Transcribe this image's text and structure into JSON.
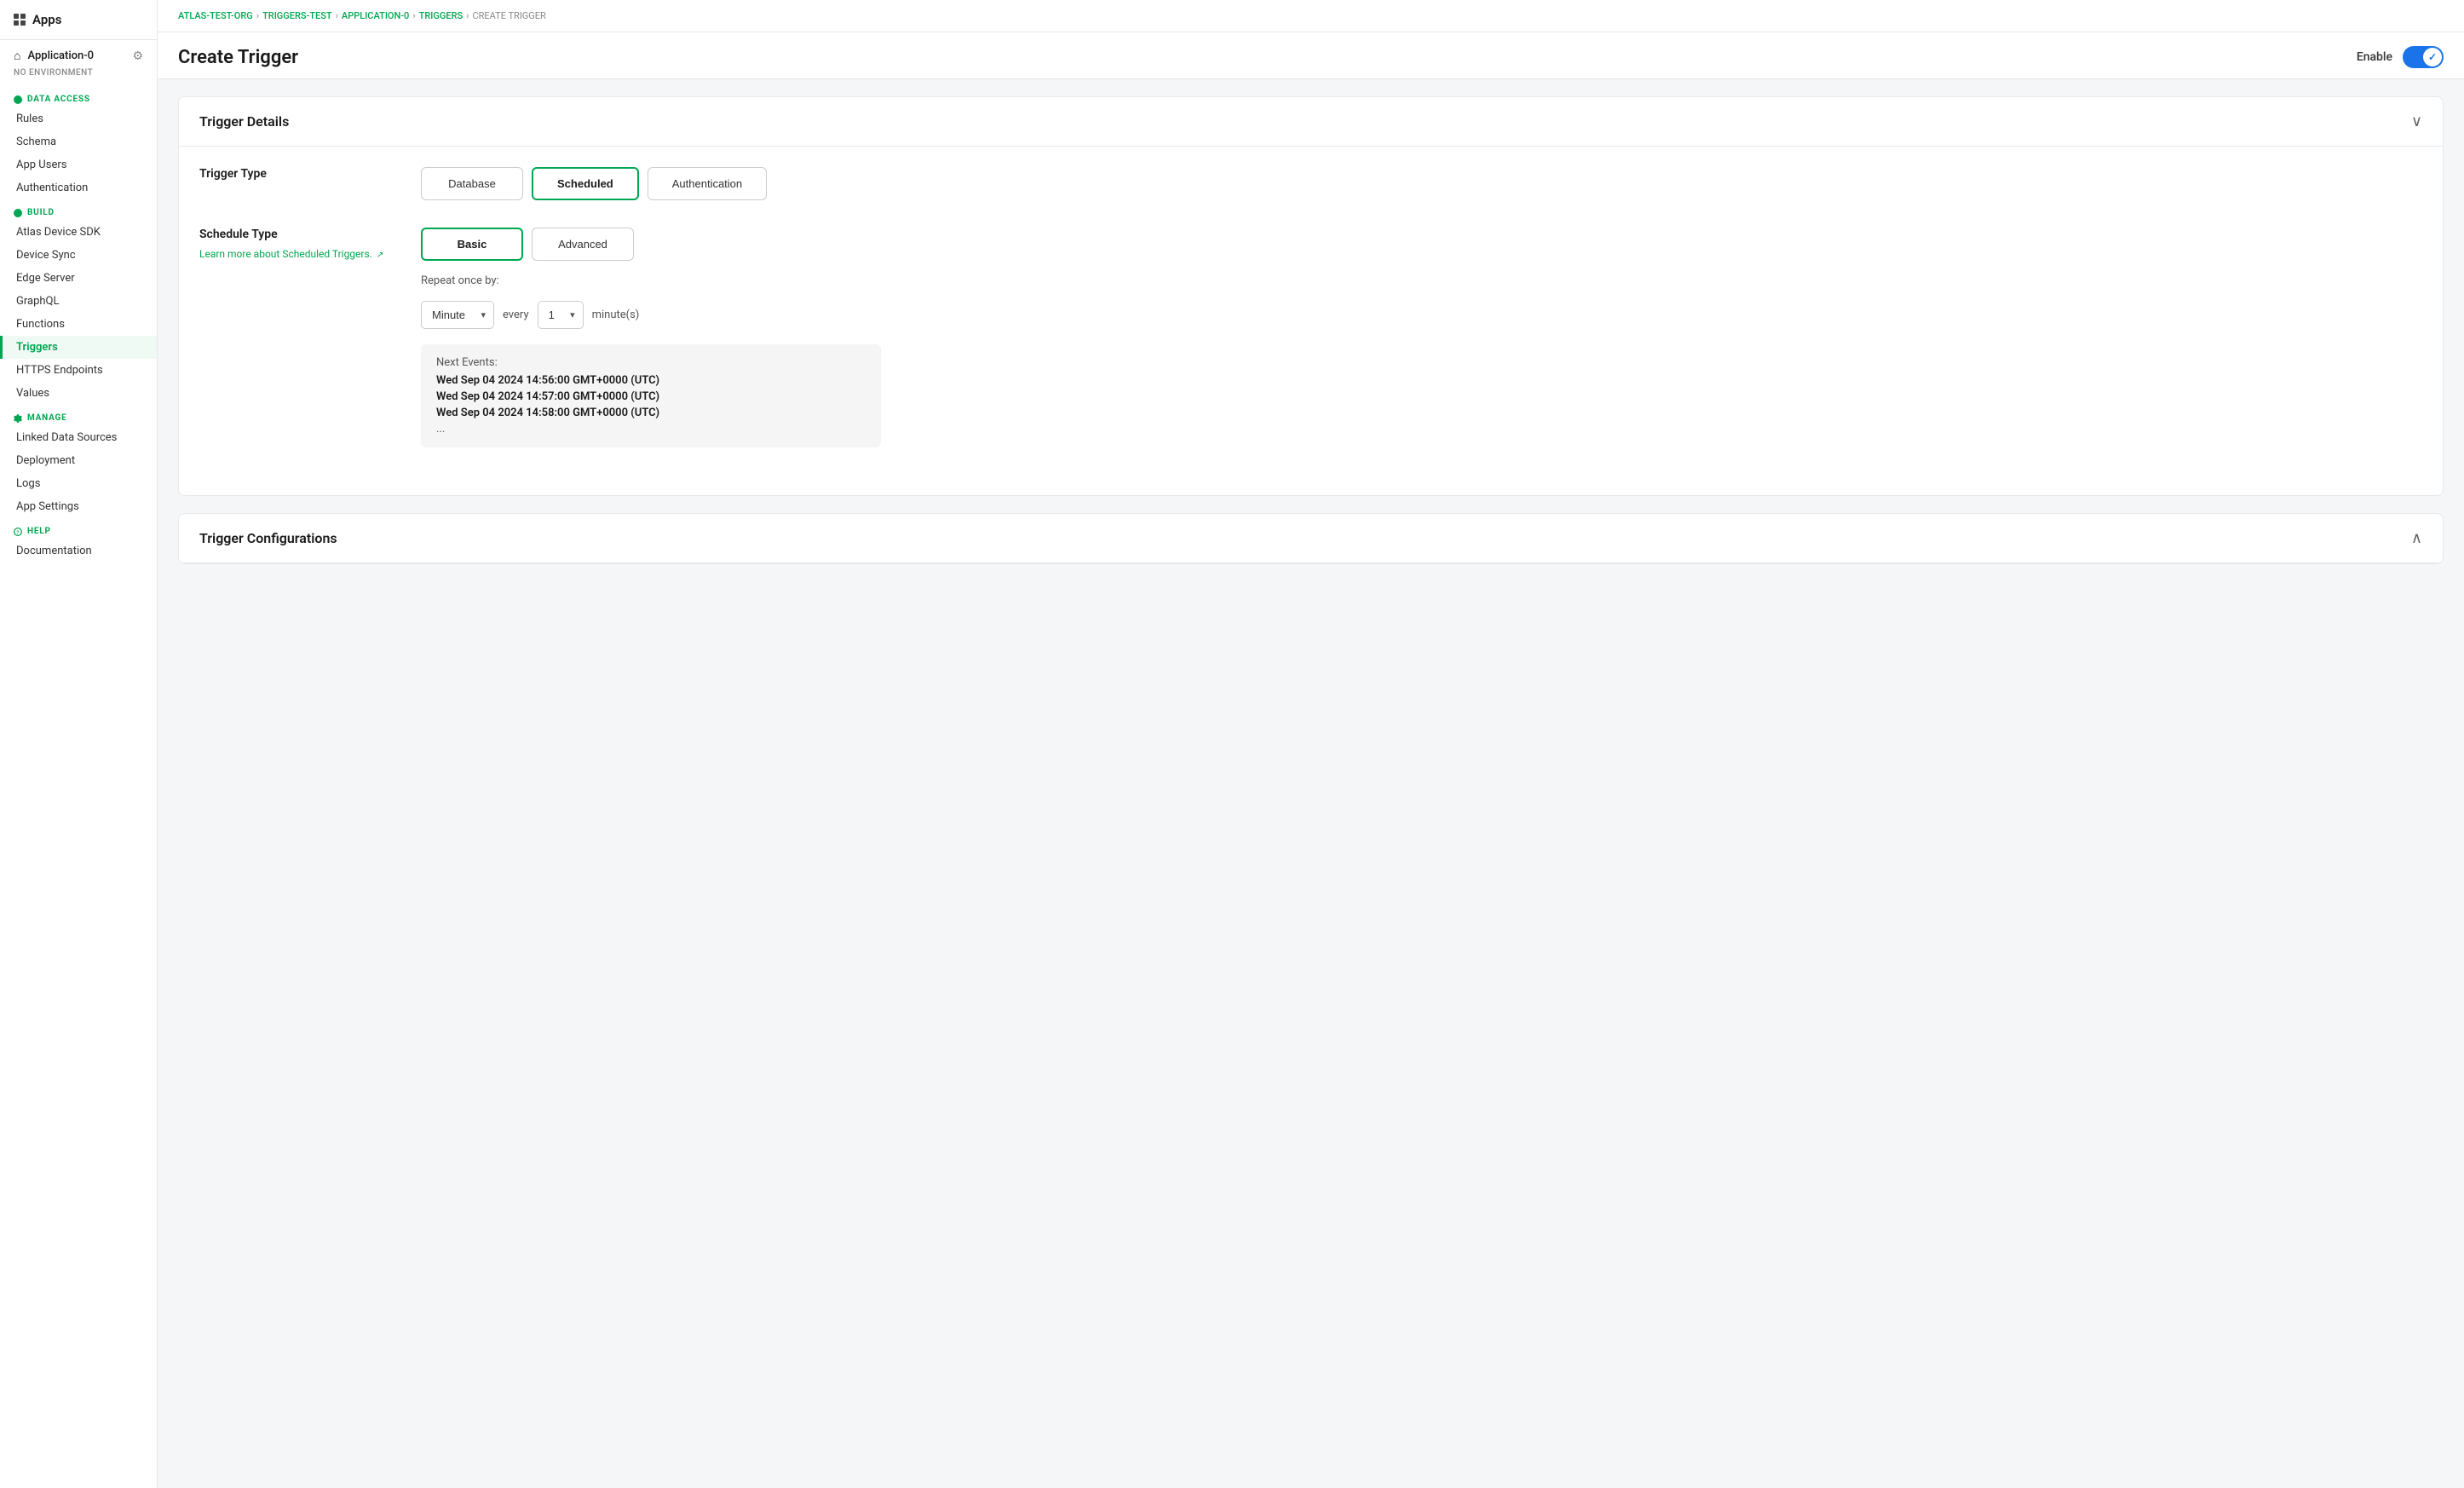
{
  "sidebar": {
    "apps_label": "Apps",
    "app_name": "Application-0",
    "env_label": "NO ENVIRONMENT",
    "data_access_label": "DATA ACCESS",
    "build_label": "BUILD",
    "manage_label": "MANAGE",
    "help_label": "HELP",
    "items_data_access": [
      {
        "id": "rules",
        "label": "Rules"
      },
      {
        "id": "schema",
        "label": "Schema"
      },
      {
        "id": "app-users",
        "label": "App Users"
      },
      {
        "id": "authentication",
        "label": "Authentication"
      }
    ],
    "items_build": [
      {
        "id": "atlas-device-sdk",
        "label": "Atlas Device SDK"
      },
      {
        "id": "device-sync",
        "label": "Device Sync"
      },
      {
        "id": "edge-server",
        "label": "Edge Server"
      },
      {
        "id": "graphql",
        "label": "GraphQL"
      },
      {
        "id": "functions",
        "label": "Functions"
      },
      {
        "id": "triggers",
        "label": "Triggers"
      },
      {
        "id": "https-endpoints",
        "label": "HTTPS Endpoints"
      },
      {
        "id": "values",
        "label": "Values"
      }
    ],
    "items_manage": [
      {
        "id": "linked-data-sources",
        "label": "Linked Data Sources"
      },
      {
        "id": "deployment",
        "label": "Deployment"
      },
      {
        "id": "logs",
        "label": "Logs"
      },
      {
        "id": "app-settings",
        "label": "App Settings"
      }
    ],
    "items_help": [
      {
        "id": "documentation",
        "label": "Documentation"
      }
    ]
  },
  "breadcrumb": {
    "atlas": "ATLAS-TEST-ORG",
    "triggers_test": "TRIGGERS-TEST",
    "application_0": "APPLICATION-0",
    "triggers": "TRIGGERS",
    "current": "CREATE TRIGGER",
    "sep": "›"
  },
  "page": {
    "title": "Create Trigger",
    "enable_label": "Enable"
  },
  "trigger_details": {
    "section_title": "Trigger Details",
    "trigger_type_label": "Trigger Type",
    "type_options": [
      {
        "id": "database",
        "label": "Database"
      },
      {
        "id": "scheduled",
        "label": "Scheduled"
      },
      {
        "id": "authentication",
        "label": "Authentication"
      }
    ],
    "schedule_type_label": "Schedule Type",
    "schedule_link_text": "Learn more about Scheduled Triggers.",
    "schedule_options": [
      {
        "id": "basic",
        "label": "Basic"
      },
      {
        "id": "advanced",
        "label": "Advanced"
      }
    ],
    "repeat_once_label": "Repeat once by:",
    "minute_option": "Minute",
    "every_label": "every",
    "count_value": "1",
    "minutes_label": "minute(s)",
    "next_events_title": "Next Events:",
    "next_events": [
      "Wed Sep 04 2024 14:56:00 GMT+0000 (UTC)",
      "Wed Sep 04 2024 14:57:00 GMT+0000 (UTC)",
      "Wed Sep 04 2024 14:58:00 GMT+0000 (UTC)"
    ],
    "ellipsis": "..."
  },
  "trigger_configurations": {
    "section_title": "Trigger Configurations"
  },
  "colors": {
    "green": "#00a651",
    "blue_toggle": "#1a73e8"
  }
}
